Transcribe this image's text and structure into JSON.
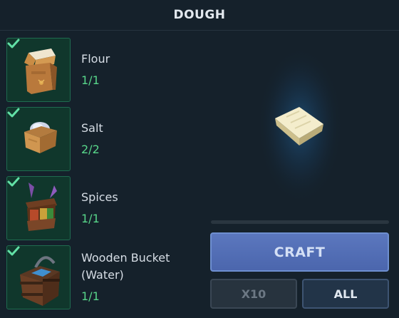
{
  "recipe": {
    "title": "DOUGH"
  },
  "ingredients": [
    {
      "name": "Flour",
      "count": "1/1",
      "icon": "flour-sack-icon",
      "complete": true
    },
    {
      "name": "Salt",
      "count": "2/2",
      "icon": "salt-box-icon",
      "complete": true
    },
    {
      "name": "Spices",
      "count": "1/1",
      "icon": "spices-box-icon",
      "complete": true
    },
    {
      "name": "Wooden Bucket (Water)",
      "count": "1/1",
      "icon": "wooden-bucket-icon",
      "complete": true
    }
  ],
  "output": {
    "icon": "dough-icon"
  },
  "actions": {
    "craft": "CRAFT",
    "x10": "X10",
    "all": "ALL"
  },
  "colors": {
    "background": "#15212b",
    "slot_bg": "#10372c",
    "slot_border": "#1f6b50",
    "count_green": "#58d68a",
    "craft_button": "#5670b8"
  }
}
